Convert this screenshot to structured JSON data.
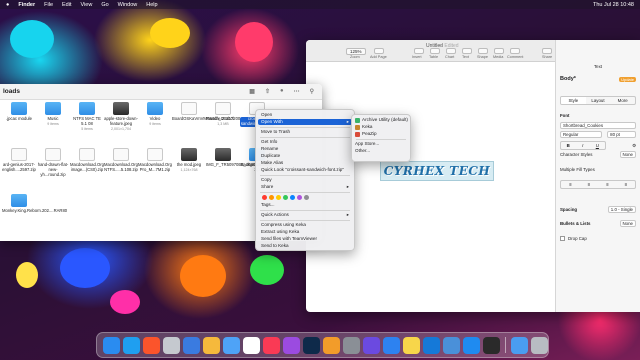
{
  "menubar": {
    "apple": "",
    "app": "Finder",
    "items": [
      "File",
      "Edit",
      "View",
      "Go",
      "Window",
      "Help"
    ],
    "clock": "Thu Jul 28 10:48"
  },
  "finder": {
    "title": "loads",
    "items": [
      {
        "name": ".jpcac module",
        "size": "",
        "kind": "folder"
      },
      {
        "name": "Music",
        "size": "9 items",
        "kind": "folder"
      },
      {
        "name": "NTFS MAC TE 5.1 08",
        "size": "5 items",
        "kind": "folder"
      },
      {
        "name": "apple-store-down-feature.jpeg",
        "size": "2,001×1,704",
        "kind": "img"
      },
      {
        "name": "Video",
        "size": "9 items",
        "kind": "folder"
      },
      {
        "name": "BoardOSKaVmVMWatch_t2.abol",
        "size": "",
        "kind": "doc"
      },
      {
        "name": "Rumble.20217200p.AMZN...R07Ok",
        "size": "1,3 MB",
        "kind": "doc"
      },
      {
        "name": "croissant-sandwich-font.zip",
        "size": "",
        "kind": "doc"
      },
      {
        "name": "ard-genius-2017-english....2597.zip",
        "size": "",
        "kind": "doc"
      },
      {
        "name": "hand-drawn-flat-new-yh...round.zip",
        "size": "",
        "kind": "doc"
      },
      {
        "name": "Macdownload.Org image...(CS0).zip",
        "size": "",
        "kind": "doc"
      },
      {
        "name": "Macdownload.Org NTFS.....5.108.zip",
        "size": "",
        "kind": "doc"
      },
      {
        "name": "Macdownload.Org Pro_M...7M1.zip",
        "size": "",
        "kind": "doc"
      },
      {
        "name": "the mod.jpeg",
        "size": "1,124×768",
        "kind": "img"
      },
      {
        "name": "IMG_F_TR50970B8_4948...S.zip.jpeg",
        "size": "",
        "kind": "img"
      },
      {
        "name": "ttackgrounds.app zip",
        "size": "",
        "kind": "folder"
      },
      {
        "name": "Monkey.King.Reborn.202....RAR80",
        "size": "",
        "kind": "folder"
      }
    ]
  },
  "textedit": {
    "title": "Untitled",
    "subtitle": "— Edited",
    "zoom": "125%",
    "toolbar_labels": [
      "Zoom",
      "Add Page",
      "Insert",
      "Table",
      "Chart",
      "Text",
      "Shape",
      "Media",
      "Comment",
      "Share",
      "Format",
      "Document"
    ],
    "logo_text": "CYRHEX TECH"
  },
  "inspector": {
    "header": "Text",
    "style_name": "Body*",
    "update_label": "Update",
    "tabs": [
      "Style",
      "Layout",
      "More"
    ],
    "font_section": "Font",
    "font_family": "Shortbread_Cookies",
    "font_style": "Regular",
    "font_size": "80 pt",
    "char_styles_label": "Character Styles",
    "char_styles_value": "None",
    "fill_label": "Multiple Fill Types",
    "spacing_label": "Spacing",
    "spacing_value": "1.0 - Single",
    "bullets_label": "Bullets & Lists",
    "bullets_value": "None",
    "dropcap_label": "Drop Cap"
  },
  "context_menu": {
    "items": [
      "Open",
      "Open With",
      "Move to Trash",
      "Get Info",
      "Rename",
      "Duplicate",
      "Make Alias",
      "Quick Look \"croissant-sandwich-font.zip\"",
      "Copy",
      "Share",
      "Tags...",
      "Quick Actions",
      "Compress using Keka",
      "Extract using Keka",
      "Send files with TeamViewer",
      "Send to Keka"
    ],
    "tag_colors": [
      "#ff3b30",
      "#ff9500",
      "#ffcc00",
      "#34c759",
      "#0a84ff",
      "#af52de",
      "#8e8e93"
    ]
  },
  "submenu": {
    "items": [
      {
        "label": "Archive Utility (default)",
        "color": "#3bb36a"
      },
      {
        "label": "Keka",
        "color": "#c7842e"
      },
      {
        "label": "PeaZip",
        "color": "#d94b39"
      },
      {
        "label": "App Store...",
        "color": ""
      },
      {
        "label": "Other...",
        "color": ""
      }
    ]
  },
  "dock": {
    "apps": [
      {
        "name": "Finder",
        "color": "#2a8cf0"
      },
      {
        "name": "Safari",
        "color": "#1f9ff0"
      },
      {
        "name": "Brave",
        "color": "#fb542b"
      },
      {
        "name": "Launchpad",
        "color": "#c5c9cf"
      },
      {
        "name": "Files",
        "color": "#3a7be0"
      },
      {
        "name": "Photos",
        "color": "#f5b93c"
      },
      {
        "name": "Mail",
        "color": "#4ea3f7"
      },
      {
        "name": "Calendar",
        "color": "#ffffff"
      },
      {
        "name": "Music",
        "color": "#fa3a55"
      },
      {
        "name": "Podcasts",
        "color": "#9b4be0"
      },
      {
        "name": "Photoshop",
        "color": "#0e2a4a"
      },
      {
        "name": "Pages",
        "color": "#f29c2a"
      },
      {
        "name": "System Preferences",
        "color": "#8a8f96"
      },
      {
        "name": "iMovie",
        "color": "#6b4ae0"
      },
      {
        "name": "Keynote",
        "color": "#2d82f0"
      },
      {
        "name": "Notes",
        "color": "#f7d64a"
      },
      {
        "name": "TeamViewer",
        "color": "#1579d8"
      },
      {
        "name": "Preview",
        "color": "#4a90d9"
      },
      {
        "name": "App Store",
        "color": "#1f8bf0"
      },
      {
        "name": "QuickTime",
        "color": "#2a2a2a"
      },
      {
        "name": "Downloads",
        "color": "#4a9df0"
      },
      {
        "name": "Trash",
        "color": "#b8bcc2"
      }
    ]
  }
}
